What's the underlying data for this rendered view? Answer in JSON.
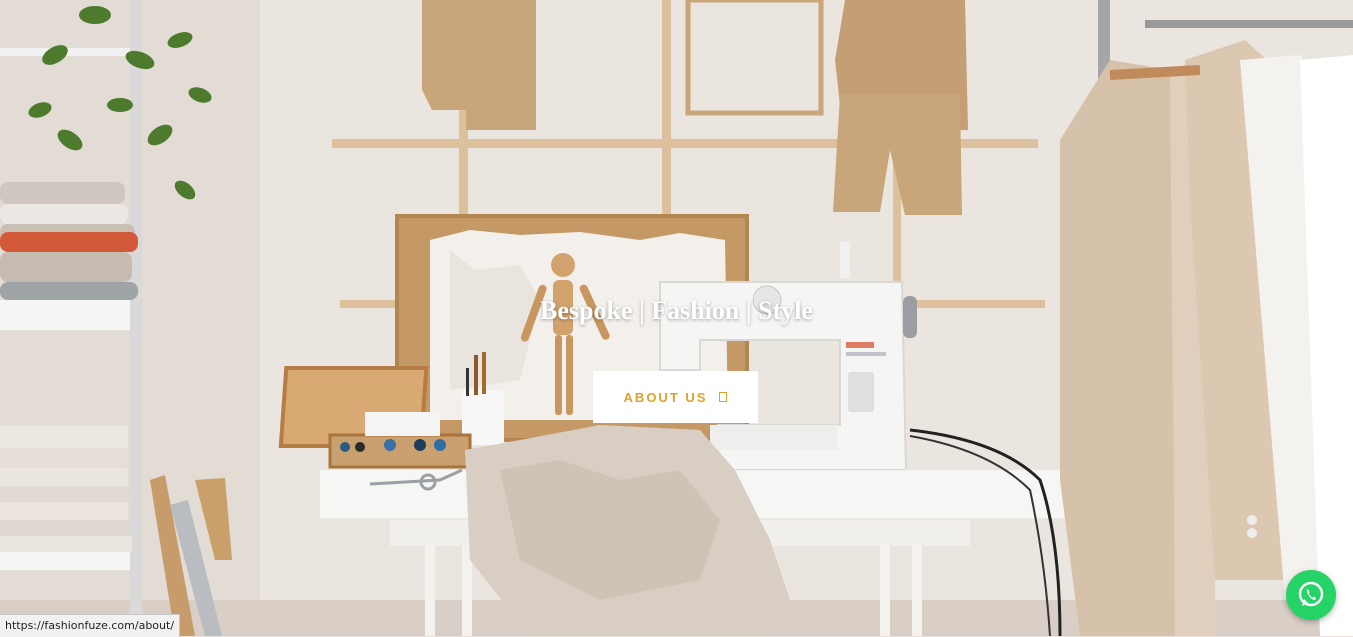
{
  "hero": {
    "title": "Bespoke | Fashion | Style",
    "cta_label": "ABOUT US",
    "cta_icon": "arrow-right-icon",
    "scene": "tailor-workshop-photo"
  },
  "floating": {
    "whatsapp_icon": "whatsapp-icon"
  },
  "status_bar": {
    "url": "https://fashionfuze.com/about/"
  },
  "colors": {
    "accent": "#e0a12b",
    "button_bg": "#ffffff",
    "whatsapp_green": "#25d366",
    "wall": "#e9e2dc"
  }
}
